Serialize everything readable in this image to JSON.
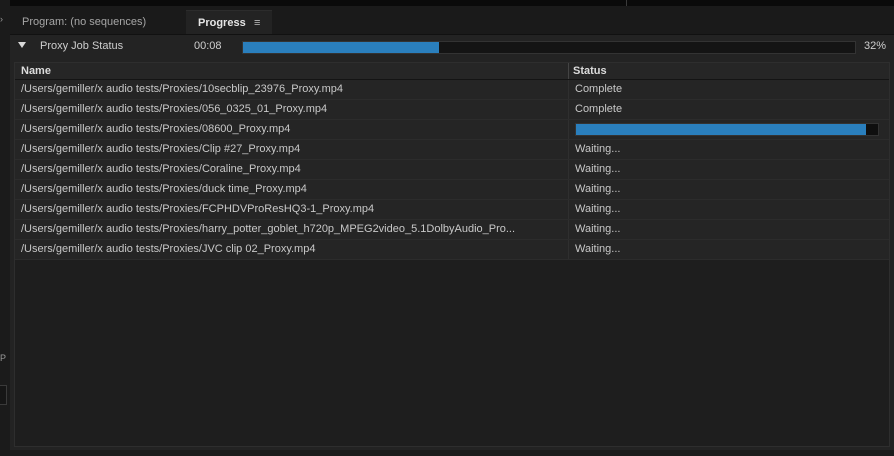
{
  "tabs": {
    "program_label": "Program: (no sequences)",
    "progress_label": "Progress",
    "progress_menu_icon": "menu-icon"
  },
  "proxy_job": {
    "label": "Proxy Job Status",
    "elapsed": "00:08",
    "percent_text": "32%",
    "percent_value": 0.32
  },
  "table": {
    "headers": {
      "name": "Name",
      "status": "Status"
    },
    "rows": [
      {
        "name": "/Users/gemiller/x audio tests/Proxies/10secblip_23976_Proxy.mp4",
        "status": "Complete"
      },
      {
        "name": "/Users/gemiller/x audio tests/Proxies/056_0325_01_Proxy.mp4",
        "status": "Complete"
      },
      {
        "name": "/Users/gemiller/x audio tests/Proxies/08600_Proxy.mp4",
        "status": "",
        "progress": 0.96
      },
      {
        "name": "/Users/gemiller/x audio tests/Proxies/Clip #27_Proxy.mp4",
        "status": "Waiting..."
      },
      {
        "name": "/Users/gemiller/x audio tests/Proxies/Coraline_Proxy.mp4",
        "status": "Waiting..."
      },
      {
        "name": "/Users/gemiller/x audio tests/Proxies/duck time_Proxy.mp4",
        "status": "Waiting..."
      },
      {
        "name": "/Users/gemiller/x audio tests/Proxies/FCPHDVProResHQ3-1_Proxy.mp4",
        "status": "Waiting..."
      },
      {
        "name": "/Users/gemiller/x audio tests/Proxies/harry_potter_goblet_h720p_MPEG2video_5.1DolbyAudio_Pro...",
        "status": "Waiting..."
      },
      {
        "name": "/Users/gemiller/x audio tests/Proxies/JVC clip 02_Proxy.mp4",
        "status": "Waiting..."
      }
    ]
  },
  "colors": {
    "progress_fill": "#2a7fbd",
    "panel_bg": "#232323",
    "text": "#c8c8c8"
  }
}
